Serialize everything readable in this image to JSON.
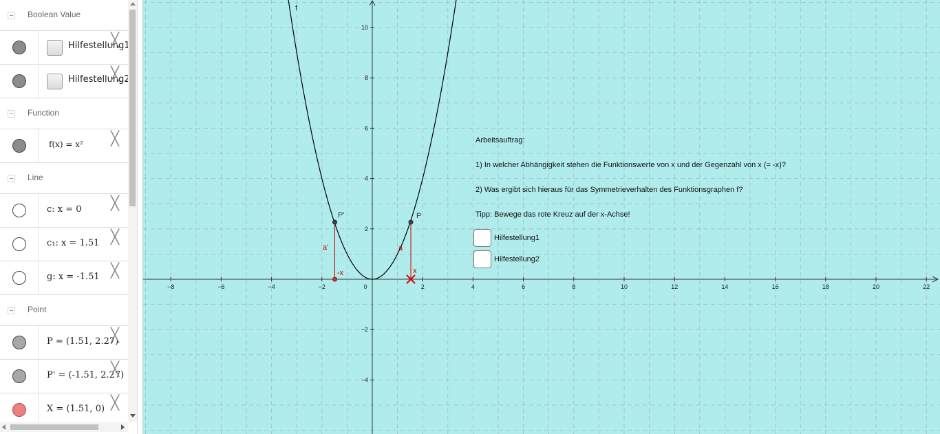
{
  "algebra": {
    "categories": {
      "boolean": "Boolean Value",
      "function": "Function",
      "line": "Line",
      "point": "Point"
    },
    "items": {
      "hilf1": "Hilfestellung1 =",
      "hilf2": "Hilfestellung2 =",
      "func": "f(x) = x²",
      "line_c": "c: x = 0",
      "line_c1": "c₁: x = 1.51",
      "line_g": "g: x = -1.51",
      "point_p": "P = (1.51, 2.27)",
      "point_pp": "P' = (-1.51, 2.27)",
      "point_x": "X = (1.51, 0)"
    },
    "close_glyph": "╳"
  },
  "graphics": {
    "x_ticks": [
      "−8",
      "−6",
      "−4",
      "−2",
      "0",
      "2",
      "4",
      "6",
      "8",
      "10",
      "12",
      "14",
      "16",
      "18",
      "20",
      "22"
    ],
    "y_ticks": [
      "10",
      "8",
      "6",
      "4",
      "2",
      "−2",
      "−4"
    ],
    "labels": {
      "curve": "f",
      "p": "P",
      "p_prime": "P'",
      "seg_a": "a",
      "seg_a_prime": "a'",
      "x_label": "x",
      "neg_x_label": "-x"
    },
    "task": {
      "title": "Arbeitsauftrag:",
      "q1": "1) In welcher Abhängigkeit stehen die Funktionswerte von x und der Gegenzahl von x (= -x)?",
      "q2": "2) Was ergibt sich hieraus für das Symmetrieverhalten des Funktionsgraphen f?",
      "tip": "Tipp: Bewege das rote Kreuz auf der x-Achse!"
    },
    "checkboxes": {
      "c1": "Hilfestellung1",
      "c2": "Hilfestellung2"
    },
    "colors": {
      "background": "#b0ecec",
      "curve": "#000000",
      "segments": "#cc0000",
      "grid": "#a3bcbc"
    }
  }
}
